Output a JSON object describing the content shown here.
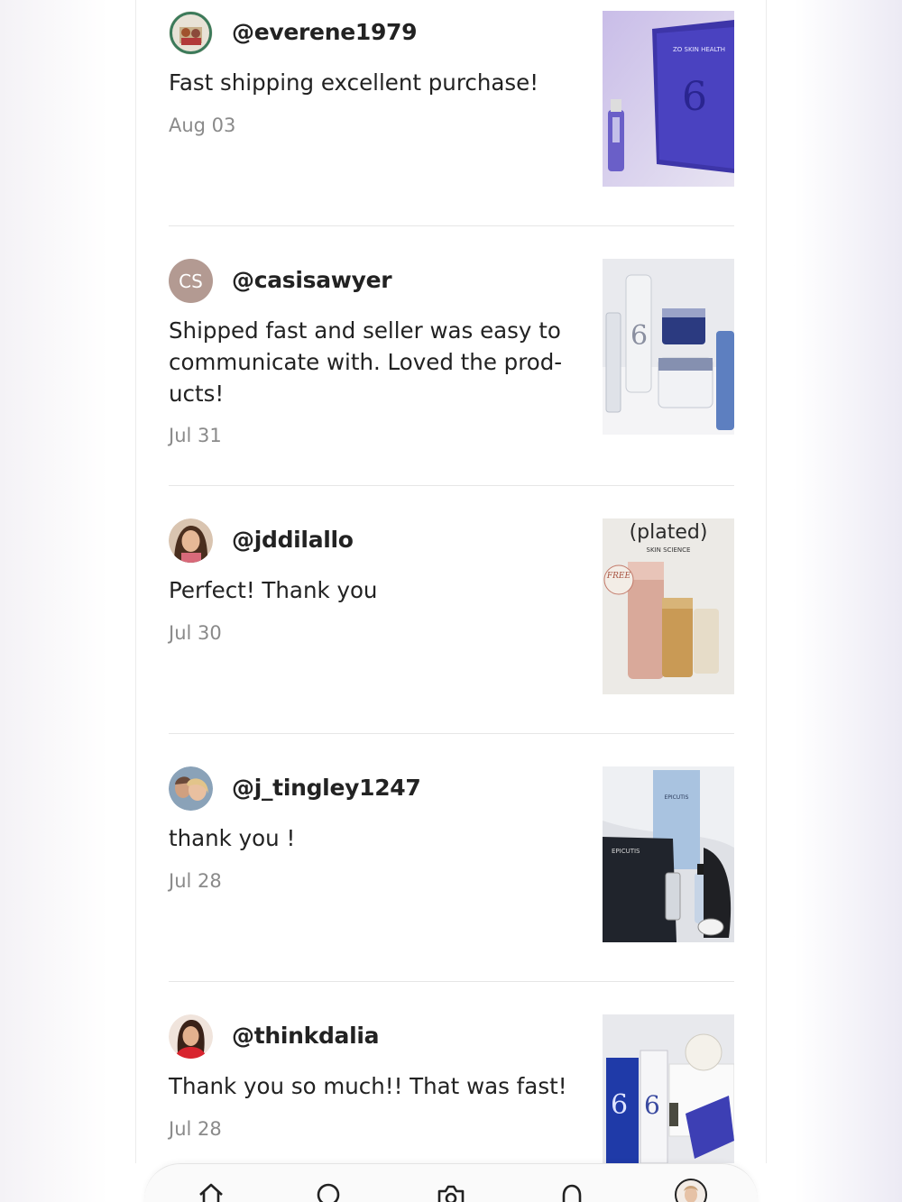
{
  "reviews": [
    {
      "username": "@everene1979",
      "comment": "Fast shipping excellent purchase!",
      "date": "Aug 03",
      "avatar_type": "photo",
      "thumb_icon": "serum-packet-product-photo"
    },
    {
      "username": "@casisawyer",
      "comment": "Shipped fast and seller was easy to communicate with. Loved the prod-ucts!",
      "comment_lines": [
        "Shipped fast and seller was easy to",
        "communicate with. Loved the prod-",
        "ucts!"
      ],
      "date": "Jul 31",
      "avatar_type": "initials",
      "avatar_initials": "CS",
      "thumb_icon": "skincare-jars-product-photo"
    },
    {
      "username": "@jddilallo",
      "comment": "Perfect! Thank you",
      "date": "Jul 30",
      "avatar_type": "photo",
      "thumb_icon": "plated-box-product-photo",
      "thumb_text": {
        "brand": "(plated)",
        "tagline": "SKIN SCIENCE",
        "badge": "FREE"
      }
    },
    {
      "username": "@j_tingley1247",
      "comment": "thank you !",
      "date": "Jul 28",
      "avatar_type": "photo",
      "thumb_icon": "epicutis-product-photo",
      "thumb_text": {
        "brand": "EPICUTIS"
      }
    },
    {
      "username": "@thinkdalia",
      "comment": "Thank you so much!! That was fast!",
      "date": "Jul 28",
      "avatar_type": "photo",
      "thumb_icon": "zo-skin-set-product-photo"
    }
  ],
  "bottom_nav": {
    "items": [
      "home-icon",
      "search-icon",
      "camera-icon",
      "notifications-icon",
      "profile-avatar"
    ]
  },
  "colors": {
    "text": "#222222",
    "date": "#8a8a8a",
    "divider": "#e6e6e6",
    "initials_avatar": "#b39a92"
  }
}
